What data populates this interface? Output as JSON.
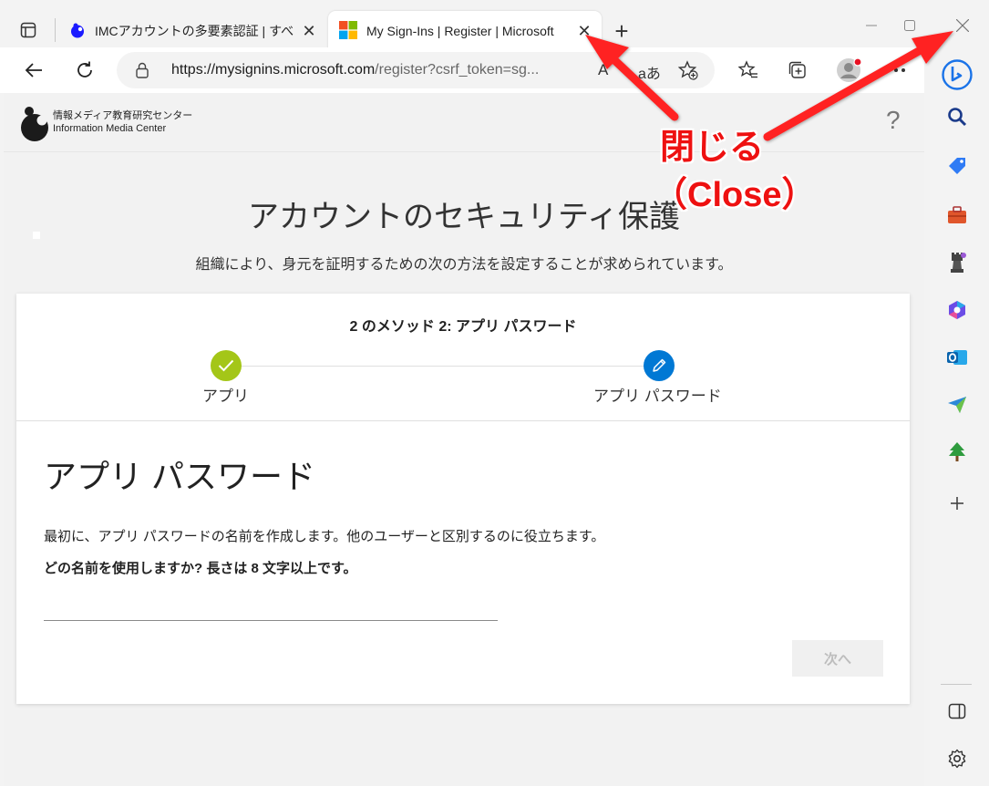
{
  "browser": {
    "tabs": [
      {
        "title": "IMCアカウントの多要素認証 | すべて",
        "active": false
      },
      {
        "title": "My Sign-Ins | Register | Microsoft",
        "active": true
      }
    ],
    "address_url_host": "https://mysignins.microsoft.com",
    "address_url_path": "/register?csrf_token=sg...",
    "reader_label": "A",
    "read_aloud_label": "aあ"
  },
  "page": {
    "logo": {
      "line1": "情報メディア教育研究センター",
      "line2": "Information Media Center"
    },
    "help_glyph": "?",
    "title": "アカウントのセキュリティ保護",
    "subtitle": "組織により、身元を証明するための次の方法を設定することが求められています。",
    "progress": {
      "caption": "2 のメソッド 2: アプリ パスワード",
      "steps": [
        {
          "label": "アプリ",
          "status": "complete"
        },
        {
          "label": "アプリ パスワード",
          "status": "current"
        }
      ]
    },
    "section_title": "アプリ パスワード",
    "description": "最初に、アプリ パスワードの名前を作成します。他のユーザーと区別するのに役立ちます。",
    "question": "どの名前を使用しますか? 長さは 8 文字以上です。",
    "name_input_value": "",
    "next_button_label": "次へ"
  },
  "annotation": {
    "line1": "閉じる",
    "line2": "（Close）",
    "color": "#ee1111"
  },
  "colors": {
    "check_green": "#a4c618",
    "step_blue": "#0078d4",
    "bing_blue": "#1a73e8"
  }
}
